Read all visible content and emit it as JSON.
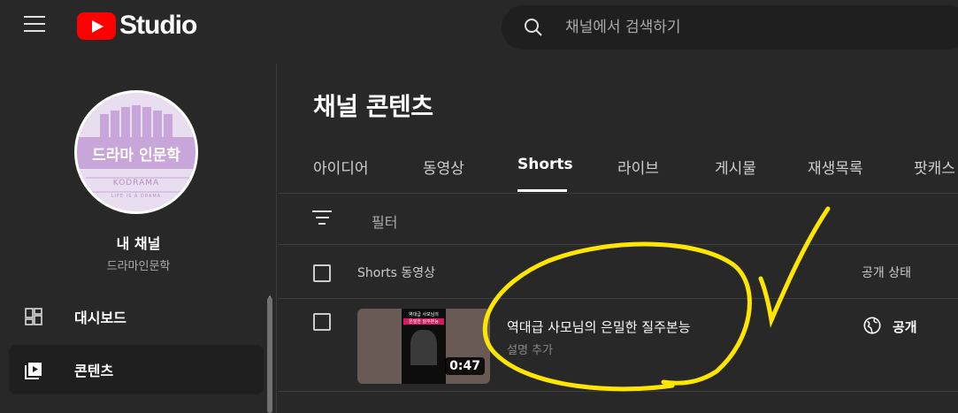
{
  "header": {
    "logo_text": "Studio",
    "search_placeholder": "채널에서 검색하기"
  },
  "sidebar": {
    "avatar": {
      "title": "드라마 인문학",
      "subtitle": "KODRAMA",
      "tagline": "LIFE IS A DRAMA"
    },
    "channel_title": "내 채널",
    "channel_handle": "드라마인문학",
    "items": [
      {
        "label": "대시보드",
        "icon": "dashboard-icon",
        "active": false
      },
      {
        "label": "콘텐츠",
        "icon": "content-icon",
        "active": true
      }
    ]
  },
  "main": {
    "page_title": "채널 콘텐츠",
    "tabs": [
      {
        "label": "아이디어",
        "active": false
      },
      {
        "label": "동영상",
        "active": false
      },
      {
        "label": "Shorts",
        "active": true
      },
      {
        "label": "라이브",
        "active": false
      },
      {
        "label": "게시물",
        "active": false
      },
      {
        "label": "재생목록",
        "active": false
      },
      {
        "label": "팟캐스",
        "active": false
      }
    ],
    "filter_label": "필터",
    "columns": {
      "video": "Shorts 동영상",
      "visibility": "공개 상태"
    },
    "rows": [
      {
        "title": "역대급 사모님의 은밀한 질주본능",
        "description": "설명 추가",
        "duration": "0:47",
        "visibility": "공개",
        "thumbnail": {
          "line1": "역대급 사모님의",
          "line2": "은밀한 질주본능"
        }
      }
    ]
  },
  "colors": {
    "background": "#282828",
    "brand_red": "#ff0000",
    "annotation": "#ffe600",
    "avatar_bg": "#e9def0",
    "avatar_accent": "#c9a6d9"
  }
}
